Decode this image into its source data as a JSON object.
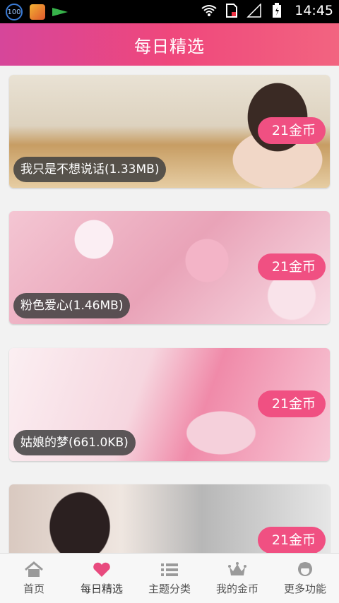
{
  "status_bar": {
    "badge_text": "100",
    "time": "14:45",
    "icons": [
      "badge-icon",
      "shield-icon",
      "arrow-icon",
      "wifi-icon",
      "sim-icon",
      "signal-icon",
      "battery-icon"
    ]
  },
  "header": {
    "title": "每日精选"
  },
  "cards": [
    {
      "name": "我只是不想说话(1.33MB)",
      "price": "21金币"
    },
    {
      "name": "粉色爱心(1.46MB)",
      "price": "21金币"
    },
    {
      "name": "姑娘的梦(661.0KB)",
      "price": "21金币"
    },
    {
      "name": "",
      "price": "21金币"
    }
  ],
  "tabs": [
    {
      "label": "首页",
      "icon": "home-icon",
      "active": false
    },
    {
      "label": "每日精选",
      "icon": "heart-icon",
      "active": true
    },
    {
      "label": "主题分类",
      "icon": "list-icon",
      "active": false
    },
    {
      "label": "我的金币",
      "icon": "crown-icon",
      "active": false
    },
    {
      "label": "更多功能",
      "icon": "person-icon",
      "active": false
    }
  ],
  "colors": {
    "accent": "#f05082",
    "header_start": "#d6469a",
    "header_end": "#f26480",
    "active_icon": "#e84a7e",
    "inactive_icon": "#9a9a9a"
  }
}
